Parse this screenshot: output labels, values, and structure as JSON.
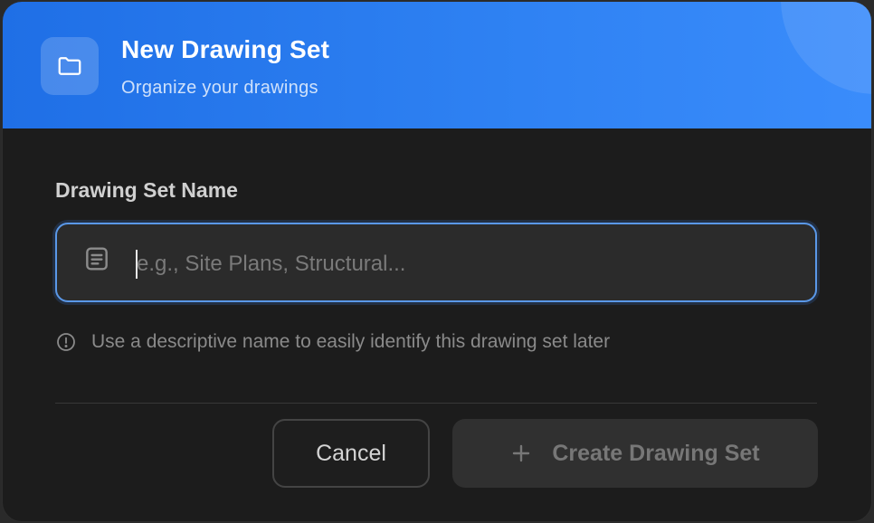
{
  "header": {
    "title": "New Drawing Set",
    "subtitle": "Organize your drawings",
    "icon": "folder-icon",
    "gradient_start": "#1f6fe6",
    "gradient_end": "#3a8cfb"
  },
  "form": {
    "label": "Drawing Set Name",
    "input_value": "",
    "input_placeholder": "e.g., Site Plans, Structural...",
    "input_icon": "document-lines-icon",
    "focus_color": "#5a98e8",
    "hint_icon": "info-icon",
    "hint": "Use a descriptive name to easily identify this drawing set later"
  },
  "actions": {
    "cancel_label": "Cancel",
    "create_label": "Create Drawing Set",
    "create_icon": "plus-icon",
    "create_disabled": true
  }
}
